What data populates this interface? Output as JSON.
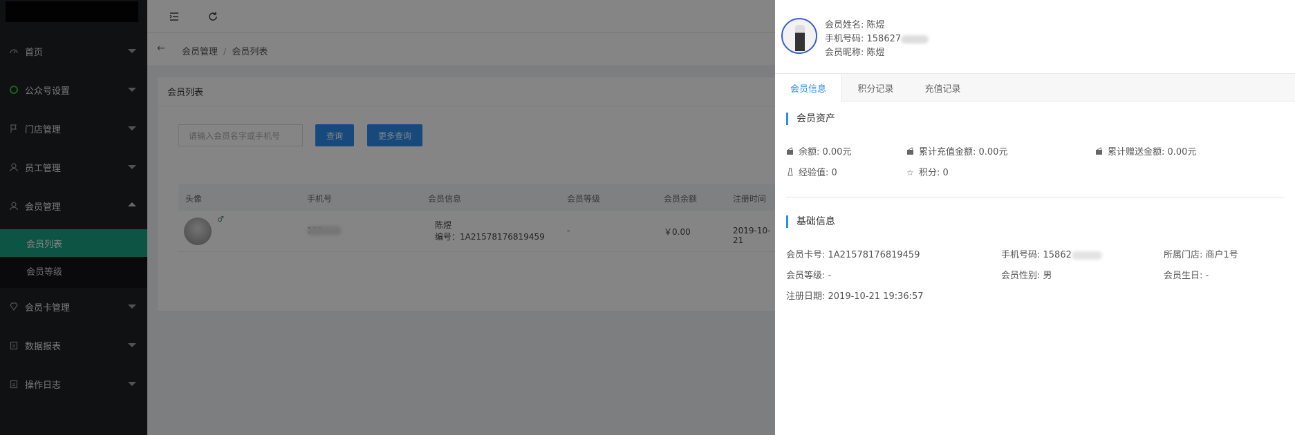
{
  "sidebar": {
    "items": [
      {
        "label": "首页",
        "icon": "dashboard-icon"
      },
      {
        "label": "公众号设置",
        "icon": "wechat-icon"
      },
      {
        "label": "门店管理",
        "icon": "flag-icon"
      },
      {
        "label": "员工管理",
        "icon": "user-icon"
      },
      {
        "label": "会员管理",
        "icon": "member-icon"
      },
      {
        "label": "会员卡管理",
        "icon": "diamond-icon"
      },
      {
        "label": "数据报表",
        "icon": "clipboard-icon"
      },
      {
        "label": "操作日志",
        "icon": "clipboard-icon"
      }
    ],
    "sub_items": [
      {
        "label": "会员列表"
      },
      {
        "label": "会员等级"
      }
    ]
  },
  "breadcrumb": [
    "会员管理",
    "会员列表"
  ],
  "card": {
    "title": "会员列表",
    "search_placeholder": "请输入会员名字或手机号",
    "query_button": "查询",
    "more_query_button": "更多查询",
    "columns": [
      "头像",
      "手机号",
      "会员信息",
      "会员等级",
      "会员余额",
      "注册时间"
    ],
    "row": {
      "phone": "158",
      "name": "陈煜",
      "number": "编号：1A21578176819459",
      "level": "-",
      "balance": "￥0.00",
      "reg_time": "2019-10-21"
    }
  },
  "drawer": {
    "name_line": "会员姓名: 陈煜",
    "phone_line": "手机号码: 158627",
    "nickname_line": "会员昵称: 陈煜",
    "tabs": [
      "会员信息",
      "积分记录",
      "充值记录"
    ],
    "assets_title": "会员资产",
    "balance": "余额: 0.00元",
    "total_recharge": "累计充值金额: 0.00元",
    "total_gift": "累计赠送金额: 0.00元",
    "experience": "经验值: 0",
    "points": "积分: 0",
    "basic_title": "基础信息",
    "card_no": "会员卡号: 1A21578176819459",
    "phone": "手机号码: 15862",
    "store": "所属门店: 商户1号",
    "level": "会员等级: -",
    "gender": "会员性别: 男",
    "birthday": "会员生日: -",
    "reg_date": "注册日期: 2019-10-21 19:36:57"
  },
  "colors": {
    "accent": "#2d8cf0",
    "sidebar_active": "#1aa182",
    "sidebar_bg": "#1f2125"
  }
}
